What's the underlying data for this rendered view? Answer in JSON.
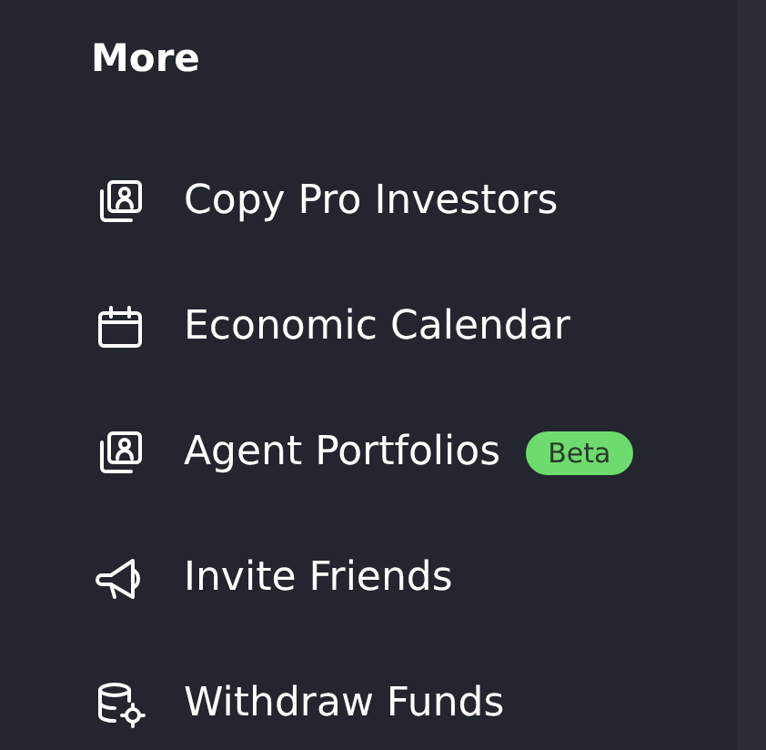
{
  "section": {
    "title": "More"
  },
  "items": [
    {
      "kind": "portrait",
      "label": "Copy Pro Investors"
    },
    {
      "kind": "calendar",
      "label": "Economic Calendar"
    },
    {
      "kind": "portrait",
      "label": "Agent Portfolios",
      "badge": "Beta"
    },
    {
      "kind": "megaphone",
      "label": "Invite Friends"
    },
    {
      "kind": "coins",
      "label": "Withdraw Funds"
    }
  ]
}
